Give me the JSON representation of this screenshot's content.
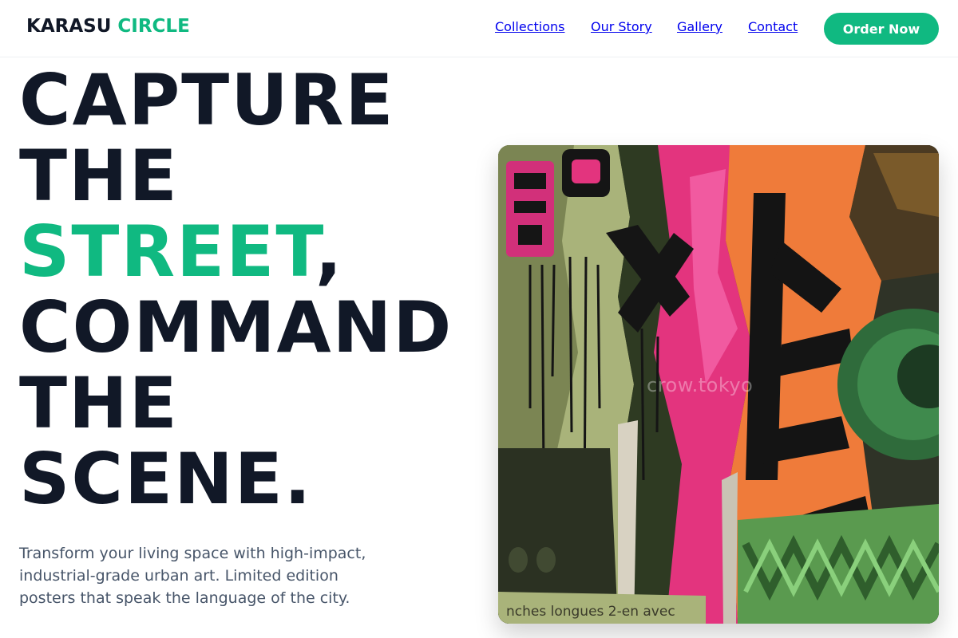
{
  "brand": {
    "name_part1": "KARASU",
    "name_part2": "CIRCLE"
  },
  "nav": {
    "items": [
      {
        "label": "Collections"
      },
      {
        "label": "Our Story"
      },
      {
        "label": "Gallery"
      },
      {
        "label": "Contact"
      }
    ],
    "cta_label": "Order Now"
  },
  "hero": {
    "headline": {
      "line1": "CAPTURE",
      "line2": "THE",
      "line3_highlight": "STREET",
      "line3_comma": ",",
      "line4": "COMMAND",
      "line5": "THE",
      "line6": "SCENE."
    },
    "description": "Transform your living space with high-impact, industrial-grade urban art. Limited edition posters that speak the language of the city.",
    "artwork": {
      "watermark": "crow.tokyo",
      "caption_text": "nches longues 2-en avec"
    }
  },
  "colors": {
    "accent": "#10b981",
    "heading": "#111827",
    "body_text": "#475569"
  }
}
